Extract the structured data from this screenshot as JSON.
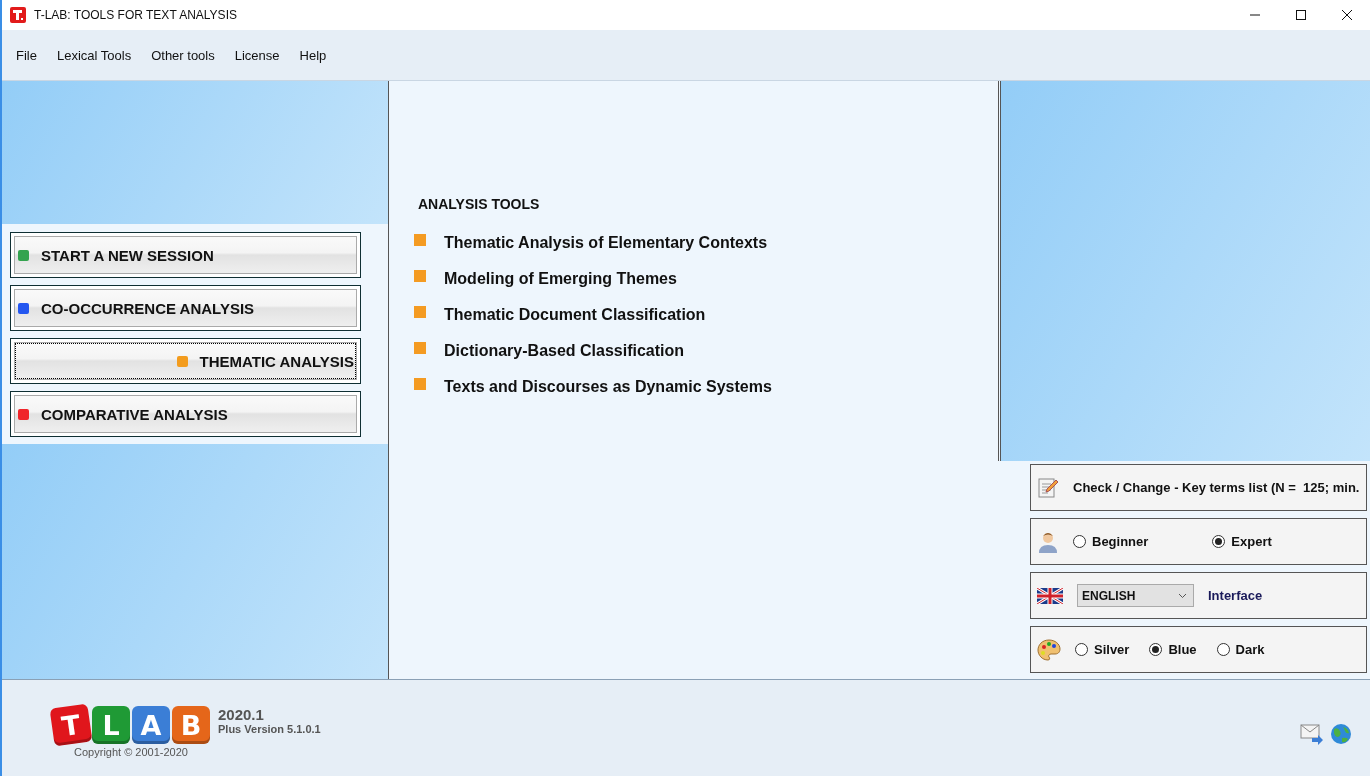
{
  "window": {
    "title": "T-LAB: TOOLS FOR TEXT ANALYSIS"
  },
  "menu": [
    "File",
    "Lexical Tools",
    "Other tools",
    "License",
    "Help"
  ],
  "modes": [
    {
      "label": "START A NEW SESSION",
      "color": "#34a34f",
      "selected": false
    },
    {
      "label": "CO-OCCURRENCE ANALYSIS",
      "color": "#2457f0",
      "selected": false
    },
    {
      "label": "THEMATIC ANALYSIS",
      "color": "#f39c1e",
      "selected": true
    },
    {
      "label": "COMPARATIVE ANALYSIS",
      "color": "#f0252a",
      "selected": false
    }
  ],
  "tools": {
    "heading": "ANALYSIS TOOLS",
    "items": [
      "Thematic Analysis of Elementary Contexts",
      "Modeling of Emerging Themes",
      "Thematic Document Classification",
      "Dictionary-Based Classification",
      "Texts and Discourses as Dynamic Systems"
    ]
  },
  "settings": {
    "key_terms": "Check / Change - Key terms list (N =  125; min.",
    "level": [
      {
        "label": "Beginner",
        "selected": false
      },
      {
        "label": "Expert",
        "selected": true
      }
    ],
    "language": {
      "value": "ENGLISH",
      "label": "Interface"
    },
    "theme": [
      {
        "label": "Silver",
        "selected": false
      },
      {
        "label": "Blue",
        "selected": true
      },
      {
        "label": "Dark",
        "selected": false
      }
    ]
  },
  "footer": {
    "logo": [
      {
        "letter": "T",
        "color": "#e0161c"
      },
      {
        "letter": "L",
        "color": "#1f9a35"
      },
      {
        "letter": "A",
        "color": "#3b7ed6"
      },
      {
        "letter": "B",
        "color": "#e5661a"
      }
    ],
    "version": "2020.1",
    "edition": "Plus Version 5.1.0.1",
    "copyright": "Copyright © 2001-2020"
  }
}
